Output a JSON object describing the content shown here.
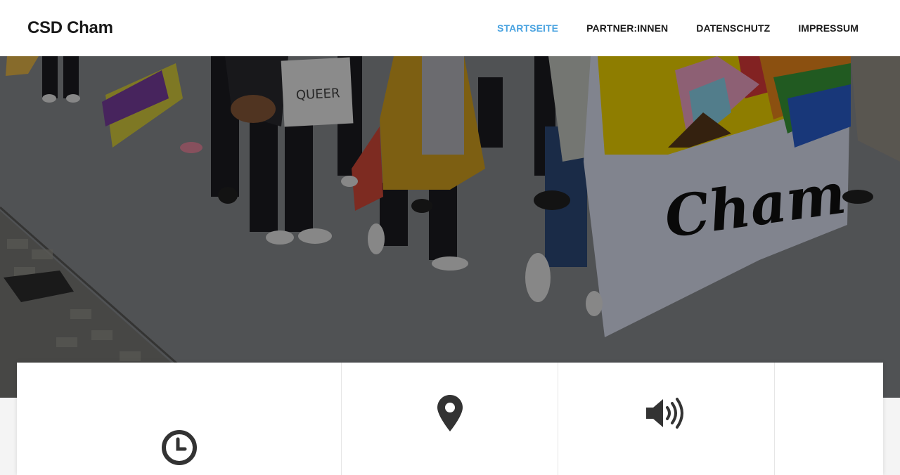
{
  "site": {
    "title": "CSD Cham"
  },
  "nav": {
    "items": [
      {
        "label": "STARTSEITE",
        "active": true
      },
      {
        "label": "PARTNER:INNEN",
        "active": false
      },
      {
        "label": "DATENSCHUTZ",
        "active": false
      },
      {
        "label": "IMPRESSUM",
        "active": false
      }
    ]
  },
  "hero": {
    "sign_text": "QUEER",
    "banner_text": "Cham"
  },
  "cards": [
    {
      "icon": "clock-icon"
    },
    {
      "icon": "map-marker-icon"
    },
    {
      "icon": "volume-icon"
    },
    {
      "icon": ""
    }
  ],
  "colors": {
    "accent": "#4aa3e0",
    "text": "#1a1a1a",
    "header_bg": "#ffffff"
  }
}
